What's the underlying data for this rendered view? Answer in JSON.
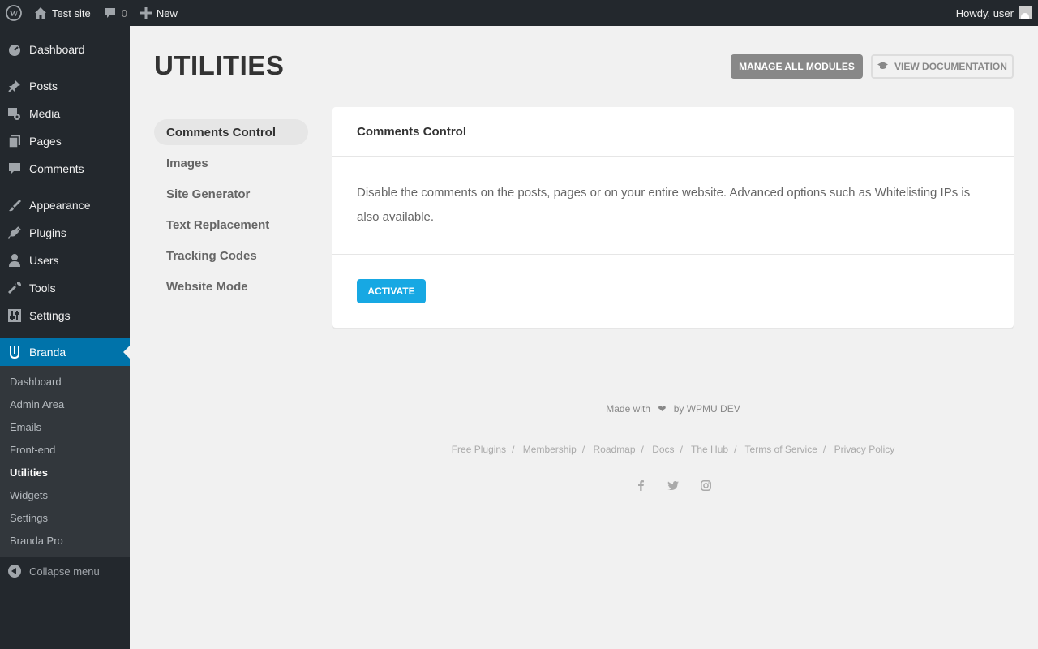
{
  "adminbar": {
    "site_name": "Test site",
    "comments_count": "0",
    "new_label": "New",
    "greeting": "Howdy, user"
  },
  "sidebar": {
    "items": [
      {
        "label": "Dashboard",
        "icon": "dashboard-icon"
      },
      {
        "label": "Posts",
        "icon": "pin-icon"
      },
      {
        "label": "Media",
        "icon": "media-icon"
      },
      {
        "label": "Pages",
        "icon": "pages-icon"
      },
      {
        "label": "Comments",
        "icon": "comment-icon"
      },
      {
        "label": "Appearance",
        "icon": "brush-icon"
      },
      {
        "label": "Plugins",
        "icon": "plug-icon"
      },
      {
        "label": "Users",
        "icon": "user-icon"
      },
      {
        "label": "Tools",
        "icon": "wrench-icon"
      },
      {
        "label": "Settings",
        "icon": "sliders-icon"
      },
      {
        "label": "Branda",
        "icon": "branda-icon"
      }
    ],
    "submenu": [
      "Dashboard",
      "Admin Area",
      "Emails",
      "Front-end",
      "Utilities",
      "Widgets",
      "Settings",
      "Branda Pro"
    ],
    "collapse_label": "Collapse menu"
  },
  "header": {
    "title": "UTILITIES",
    "manage_label": "MANAGE ALL MODULES",
    "docs_label": "VIEW DOCUMENTATION"
  },
  "nav": [
    "Comments Control",
    "Images",
    "Site Generator",
    "Text Replacement",
    "Tracking Codes",
    "Website Mode"
  ],
  "card": {
    "title": "Comments Control",
    "description": "Disable the comments on the posts, pages or on your entire website. Advanced options such as Whitelisting IPs is also available.",
    "activate_label": "ACTIVATE"
  },
  "footer": {
    "made_with": "Made with",
    "by": "by WPMU DEV",
    "links": [
      "Free Plugins",
      "Membership",
      "Roadmap",
      "Docs",
      "The Hub",
      "Terms of Service",
      "Privacy Policy"
    ]
  },
  "colors": {
    "admin_bar": "#23282d",
    "active_menu": "#0073aa",
    "activate_button": "#17a8e3",
    "manage_button": "#888888"
  }
}
